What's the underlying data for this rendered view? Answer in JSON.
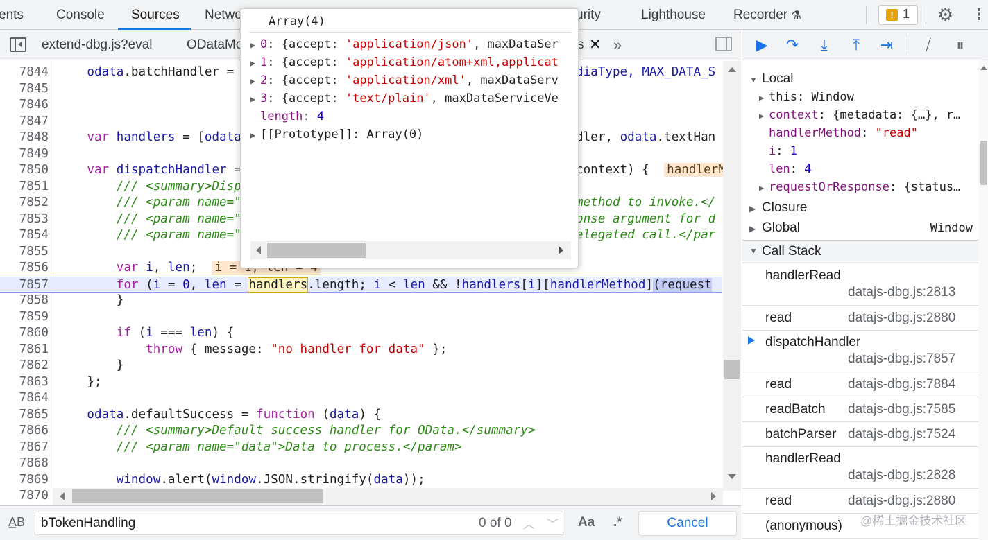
{
  "panel_tabs": [
    "ents",
    "Console",
    "Sources",
    "Netwo",
    "urity",
    "Lighthouse",
    "Recorder"
  ],
  "issues_count": "1",
  "file_tabs": [
    "extend-dbg.js?eval",
    "ODataMo",
    "s"
  ],
  "code_lines": [
    {
      "n": "7844",
      "segs": [
        [
          "    ",
          ""
        ],
        [
          "odata",
          "id"
        ],
        [
          ".batchHandler = ",
          ""
        ],
        [
          "",
          ""
        ]
      ],
      "tail": [
        [
          "diaType, MAX_DATA_S",
          "id"
        ]
      ]
    },
    {
      "n": "7845",
      "segs": []
    },
    {
      "n": "7846",
      "segs": []
    },
    {
      "n": "7847",
      "segs": []
    },
    {
      "n": "7848",
      "segs": [
        [
          "    ",
          ""
        ],
        [
          "var",
          "kw"
        ],
        [
          " ",
          ""
        ],
        [
          "handlers",
          "id"
        ],
        [
          " = [",
          ""
        ],
        [
          "odata",
          "id"
        ]
      ],
      "tail": [
        [
          "dler, ",
          ""
        ],
        [
          "odata",
          "id"
        ],
        [
          ".textHan",
          ""
        ]
      ]
    },
    {
      "n": "7849",
      "segs": []
    },
    {
      "n": "7850",
      "segs": [
        [
          "    ",
          ""
        ],
        [
          "var",
          "kw"
        ],
        [
          " ",
          ""
        ],
        [
          "dispatchHandler",
          "id"
        ],
        [
          " = ",
          ""
        ]
      ],
      "tail": [
        [
          "context) {  ",
          ""
        ],
        [
          "handlerMet",
          "inl"
        ]
      ]
    },
    {
      "n": "7851",
      "segs": [
        [
          "        ",
          ""
        ],
        [
          "/// <summary>Disp",
          "cm"
        ]
      ]
    },
    {
      "n": "7852",
      "segs": [
        [
          "        ",
          ""
        ],
        [
          "/// <param name=\"",
          "cm"
        ]
      ],
      "tail": [
        [
          "method to invoke.</",
          "cm"
        ]
      ]
    },
    {
      "n": "7853",
      "segs": [
        [
          "        ",
          ""
        ],
        [
          "/// <param name=\"",
          "cm"
        ]
      ],
      "tail": [
        [
          "onse argument for d",
          "cm"
        ]
      ]
    },
    {
      "n": "7854",
      "segs": [
        [
          "        ",
          ""
        ],
        [
          "/// <param name=\"",
          "cm"
        ]
      ],
      "tail": [
        [
          "elegated call.</par",
          "cm"
        ]
      ]
    },
    {
      "n": "7855",
      "segs": []
    },
    {
      "n": "7856",
      "segs": [
        [
          "        ",
          ""
        ],
        [
          "var",
          "kw"
        ],
        [
          " ",
          ""
        ],
        [
          "i",
          "id"
        ],
        [
          ", ",
          ""
        ],
        [
          "len",
          "id"
        ],
        [
          ";  ",
          ""
        ],
        [
          "i = 1, len = 4",
          "inl"
        ]
      ]
    },
    {
      "n": "7857",
      "exec": true,
      "segs": [
        [
          "        ",
          ""
        ],
        [
          "for",
          "kw"
        ],
        [
          " (",
          ""
        ],
        [
          "i",
          "id"
        ],
        [
          " = ",
          ""
        ],
        [
          "0",
          "num"
        ],
        [
          ", ",
          ""
        ],
        [
          "len",
          "id"
        ],
        [
          " = ",
          ""
        ],
        [
          "handlers",
          "hl"
        ],
        [
          ".length; ",
          ""
        ],
        [
          "i",
          "id"
        ],
        [
          " < ",
          ""
        ],
        [
          "len",
          "id"
        ],
        [
          " && !",
          ""
        ],
        [
          "handlers",
          "id"
        ],
        [
          "[",
          ""
        ],
        [
          "i",
          "id"
        ],
        [
          "][",
          ""
        ],
        [
          "handlerMethod",
          "id"
        ],
        [
          "]",
          ""
        ],
        [
          "(request",
          "sel"
        ]
      ]
    },
    {
      "n": "7858",
      "segs": [
        [
          "        }",
          ""
        ]
      ]
    },
    {
      "n": "7859",
      "segs": []
    },
    {
      "n": "7860",
      "segs": [
        [
          "        ",
          ""
        ],
        [
          "if",
          "kw"
        ],
        [
          " (",
          ""
        ],
        [
          "i",
          "id"
        ],
        [
          " === ",
          ""
        ],
        [
          "len",
          "id"
        ],
        [
          ") {",
          ""
        ]
      ]
    },
    {
      "n": "7861",
      "segs": [
        [
          "            ",
          ""
        ],
        [
          "throw",
          "kw"
        ],
        [
          " { message: ",
          ""
        ],
        [
          "\"no handler for data\"",
          "str"
        ],
        [
          " };",
          ""
        ]
      ]
    },
    {
      "n": "7862",
      "segs": [
        [
          "        }",
          ""
        ]
      ]
    },
    {
      "n": "7863",
      "segs": [
        [
          "    };",
          ""
        ]
      ]
    },
    {
      "n": "7864",
      "segs": []
    },
    {
      "n": "7865",
      "segs": [
        [
          "    ",
          ""
        ],
        [
          "odata",
          "id"
        ],
        [
          ".defaultSuccess = ",
          ""
        ],
        [
          "function",
          "kw"
        ],
        [
          " (",
          ""
        ],
        [
          "data",
          "id"
        ],
        [
          ") {",
          ""
        ]
      ]
    },
    {
      "n": "7866",
      "segs": [
        [
          "        ",
          ""
        ],
        [
          "/// <summary>Default success handler for OData.</summary>",
          "cm"
        ]
      ]
    },
    {
      "n": "7867",
      "segs": [
        [
          "        ",
          ""
        ],
        [
          "/// <param name=\"data\">Data to process.</param>",
          "cm"
        ]
      ]
    },
    {
      "n": "7868",
      "segs": []
    },
    {
      "n": "7869",
      "segs": [
        [
          "        ",
          ""
        ],
        [
          "window",
          "id"
        ],
        [
          ".alert(",
          ""
        ],
        [
          "window",
          "id"
        ],
        [
          ".JSON.stringify(",
          ""
        ],
        [
          "data",
          "id"
        ],
        [
          "));",
          ""
        ]
      ]
    },
    {
      "n": "7870",
      "segs": []
    }
  ],
  "popover": {
    "title": "Array(4)",
    "rows": [
      {
        "tri": true,
        "key": "0",
        "sep": ": {accept: ",
        "str": "'application/json'",
        "rest": ", maxDataSer"
      },
      {
        "tri": true,
        "key": "1",
        "sep": ": {accept: ",
        "str": "'application/atom+xml,applicat",
        "rest": ""
      },
      {
        "tri": true,
        "key": "2",
        "sep": ": {accept: ",
        "str": "'application/xml'",
        "rest": ", maxDataServ"
      },
      {
        "tri": true,
        "key": "3",
        "sep": ": {accept: ",
        "str": "'text/plain'",
        "rest": ", maxDataServiceVe"
      }
    ],
    "length_key": "length",
    "length_val": "4",
    "proto": "[[Prototype]]: Array(0)"
  },
  "search": {
    "value": "bTokenHandling",
    "match_count": "0 of 0",
    "match_case_label": "Aa",
    "regex_label": ".*",
    "cancel_label": "Cancel"
  },
  "scope": {
    "local_label": "Local",
    "rows": [
      {
        "tri": true,
        "key": "this",
        "key_class": "",
        "val": "Window",
        "val_class": ""
      },
      {
        "tri": true,
        "key": "context",
        "key_class": "skey",
        "val": "{metadata: {…}, r…",
        "val_class": ""
      },
      {
        "tri": false,
        "key": "handlerMethod",
        "key_class": "skey",
        "val": "\"read\"",
        "val_class": "sstr"
      },
      {
        "tri": false,
        "key": "i",
        "key_class": "skey",
        "val": "1",
        "val_class": "snum"
      },
      {
        "tri": false,
        "key": "len",
        "key_class": "skey",
        "val": "4",
        "val_class": "snum"
      },
      {
        "tri": true,
        "key": "requestOrResponse",
        "key_class": "skey",
        "val": "{status…",
        "val_class": ""
      }
    ],
    "closure_label": "Closure",
    "global_label": "Global",
    "global_value": "Window"
  },
  "call_stack": {
    "label": "Call Stack",
    "frames": [
      {
        "fn": "handlerRead",
        "loc": "datajs-dbg.js:2813",
        "two_line": true,
        "current": false
      },
      {
        "fn": "read",
        "loc": "datajs-dbg.js:2880",
        "two_line": false,
        "current": false
      },
      {
        "fn": "dispatchHandler",
        "loc": "datajs-dbg.js:7857",
        "two_line": true,
        "current": true
      },
      {
        "fn": "read",
        "loc": "datajs-dbg.js:7884",
        "two_line": false,
        "current": false
      },
      {
        "fn": "readBatch",
        "loc": "datajs-dbg.js:7585",
        "two_line": false,
        "current": false
      },
      {
        "fn": "batchParser",
        "loc": "datajs-dbg.js:7524",
        "two_line": false,
        "current": false
      },
      {
        "fn": "handlerRead",
        "loc": "datajs-dbg.js:2828",
        "two_line": true,
        "current": false
      },
      {
        "fn": "read",
        "loc": "datajs-dbg.js:2880",
        "two_line": false,
        "current": false
      },
      {
        "fn": "(anonymous)",
        "loc": "",
        "two_line": false,
        "current": false
      }
    ]
  },
  "watermark": "@稀土掘金技术社区"
}
